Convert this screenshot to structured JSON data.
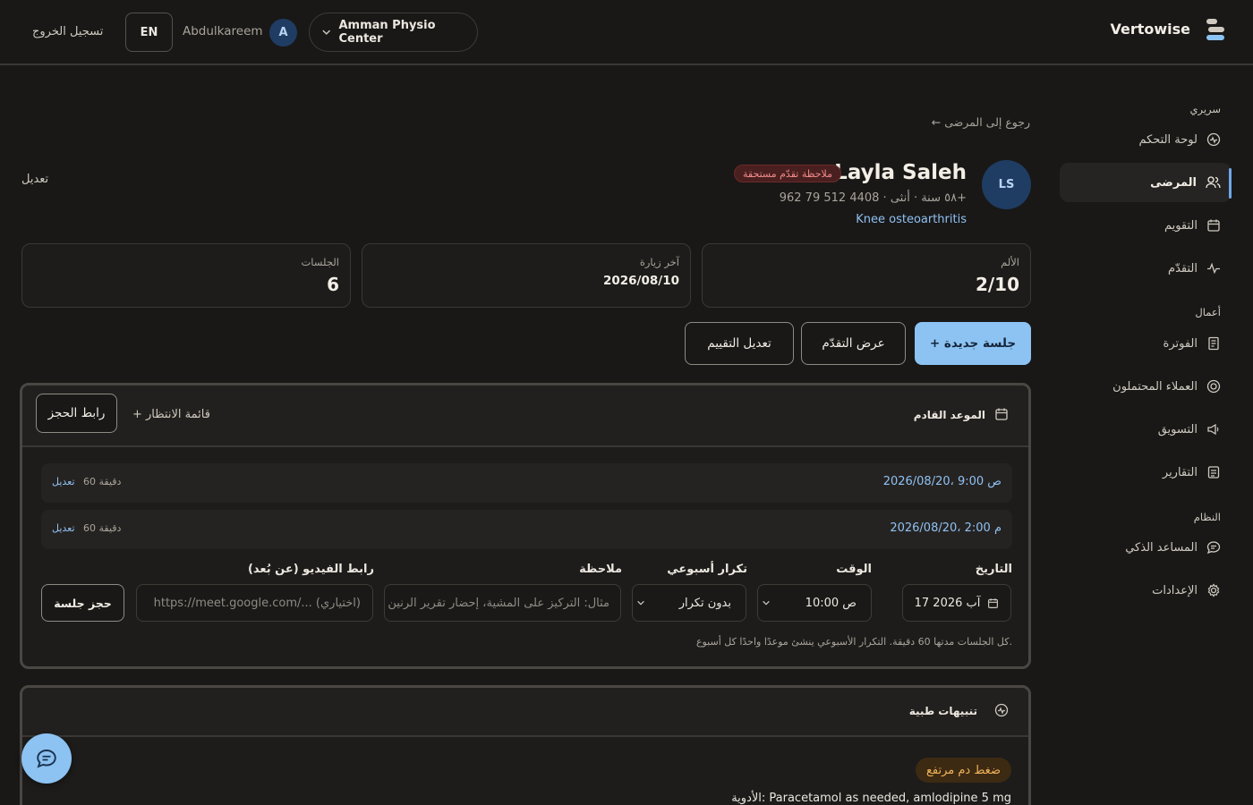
{
  "header": {
    "brand": "Vertowise",
    "clinic": "Amman Physio Center",
    "avatar_initial": "A",
    "username": "Abdulkareem",
    "lang": "EN",
    "logout": "تسجيل الخروج"
  },
  "sidebar": {
    "sections": [
      {
        "title": "سريري",
        "items": [
          {
            "label": "لوحة التحكم",
            "icon": "dashboard-icon"
          },
          {
            "label": "المرضى",
            "icon": "users-icon",
            "active": true
          },
          {
            "label": "التقويم",
            "icon": "calendar-icon"
          },
          {
            "label": "التقدّم",
            "icon": "activity-icon"
          }
        ]
      },
      {
        "title": "أعمال",
        "items": [
          {
            "label": "الفوترة",
            "icon": "invoice-icon"
          },
          {
            "label": "العملاء المحتملون",
            "icon": "target-icon"
          },
          {
            "label": "التسويق",
            "icon": "megaphone-icon"
          },
          {
            "label": "التقارير",
            "icon": "report-icon"
          }
        ]
      },
      {
        "title": "النظام",
        "items": [
          {
            "label": "المساعد الذكي",
            "icon": "chat-icon"
          },
          {
            "label": "الإعدادات",
            "icon": "gear-icon"
          }
        ]
      }
    ]
  },
  "patient": {
    "back": "← رجوع إلى المرضى",
    "initials": "LS",
    "name": "Layla Saleh",
    "badge": "ملاحظة تقدّم مستحقة",
    "meta": "٥٨ سنة · أنثى · 4408 512 79 962+",
    "diagnosis": "Knee osteoarthritis",
    "edit": "تعديل"
  },
  "stats": {
    "pain_label": "الألم",
    "pain_value": "2/10",
    "last_visit_label": "آخر زيارة",
    "last_visit_value": "2026/08/10",
    "sessions_label": "الجلسات",
    "sessions_value": "6"
  },
  "actions": {
    "new_session": "+ جلسة جديدة",
    "view_progress": "عرض التقدّم",
    "edit_assessment": "تعديل التقييم"
  },
  "appointments": {
    "title": "الموعد القادم",
    "waitlist": "+ قائمة الانتظار",
    "booking_link": "رابط الحجز",
    "slots": [
      {
        "datetime": "2026/08/20، 9:00 ص",
        "duration": "60 دقيقة",
        "edit": "تعديل"
      },
      {
        "datetime": "2026/08/20، 2:00 م",
        "duration": "60 دقيقة",
        "edit": "تعديل"
      }
    ],
    "form": {
      "date_label": "التاريخ",
      "date_value": "17 آب 2026",
      "time_label": "الوقت",
      "time_value": "10:00 ص",
      "repeat_label": "تكرار أسبوعي",
      "repeat_value": "بدون تكرار",
      "note_label": "ملاحظة",
      "note_placeholder": "مثال: التركيز على المشية، إحضار تقرير الرنين الم",
      "video_label": "رابط الفيديو (عن بُعد)",
      "video_placeholder": "https://meet.google.com/... (اختياري)",
      "book": "حجز جلسة"
    },
    "hint": "كل الجلسات مدتها 60 دقيقة. التكرار الأسبوعي ينشئ موعدًا واحدًا كل أسبوع."
  },
  "alerts": {
    "title": "تنبيهات طبية",
    "tag": "ضغط دم مرتفع",
    "meds": "الأدوية: Paracetamol as needed, amlodipine 5 mg"
  },
  "colors": {
    "accent": "#8cc3f2",
    "link": "#8fc1f3",
    "danger_bg": "#4a1f1f",
    "warning_bg": "#3d2a12"
  }
}
